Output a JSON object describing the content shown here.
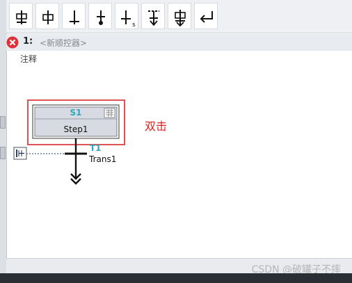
{
  "toolbar": {
    "buttons": [
      {
        "name": "insert-step-transition-icon"
      },
      {
        "name": "insert-step-icon"
      },
      {
        "name": "insert-transition-icon"
      },
      {
        "name": "insert-jump-icon"
      },
      {
        "name": "insert-simultaneous-branch-icon",
        "sub": "s"
      },
      {
        "name": "insert-alternative-branch-icon"
      },
      {
        "name": "close-branch-icon"
      },
      {
        "name": "return-icon"
      }
    ]
  },
  "chain": {
    "number": "1:",
    "name": "<新顺控器>",
    "comment": "注释",
    "status_icon": "error-icon",
    "status_color": "#e0303a"
  },
  "step": {
    "label": "S1",
    "name": "Step1",
    "highlight_color": "#d9262c"
  },
  "transition": {
    "label": "T1",
    "name": "Trans1"
  },
  "annotation": "双击",
  "watermark": "CSDN @破罐子不摔"
}
